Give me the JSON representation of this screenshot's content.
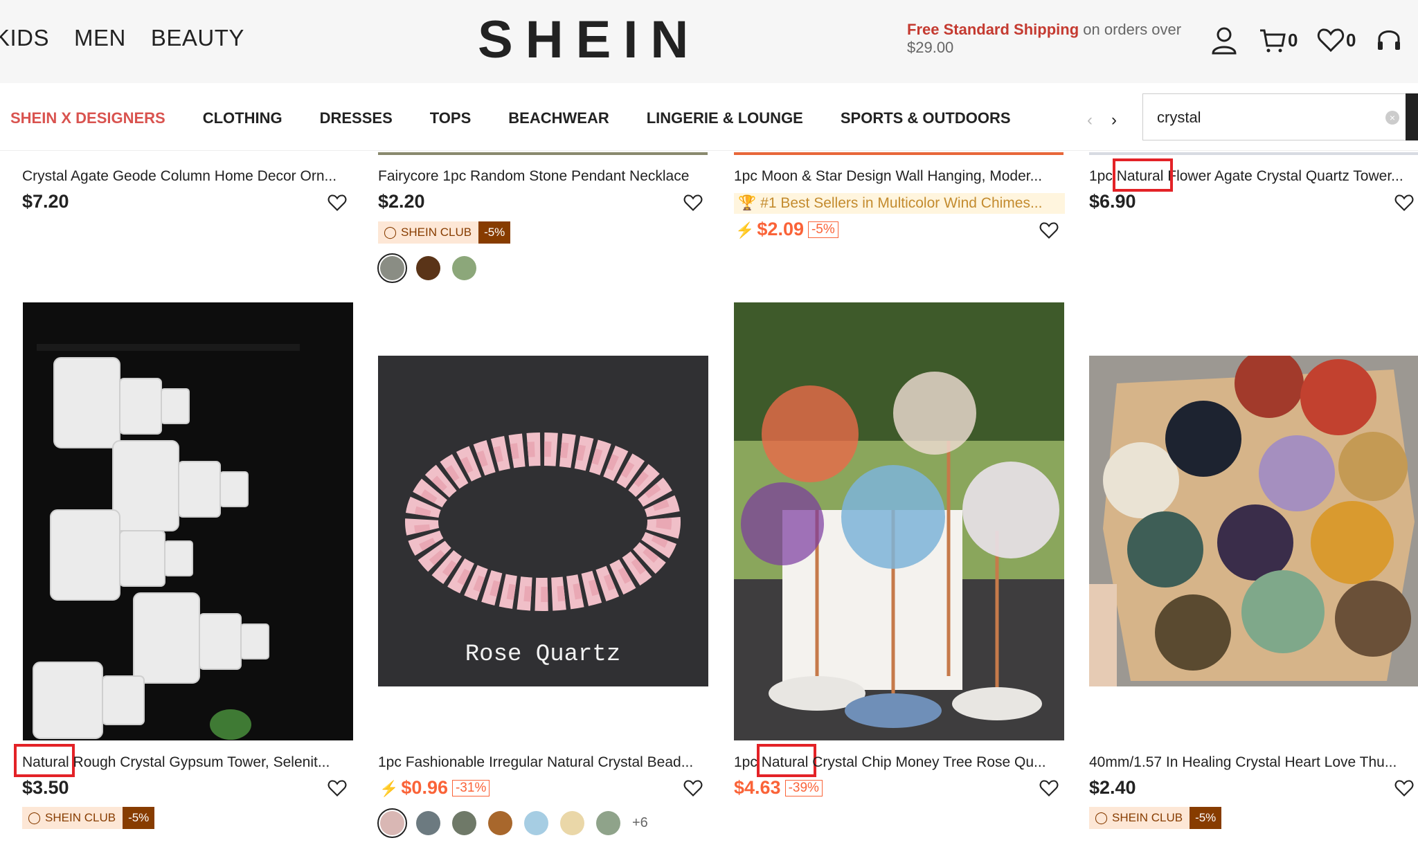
{
  "header": {
    "nav": [
      "KIDS",
      "MEN",
      "BEAUTY"
    ],
    "logo": "SHEIN",
    "shipping_highlight": "Free Standard Shipping",
    "shipping_rest": " on orders over",
    "shipping_amount": "$29.00",
    "cart_count": "0",
    "wishlist_count": "0"
  },
  "categories": [
    "SHEIN X DESIGNERS",
    "CLOTHING",
    "DRESSES",
    "TOPS",
    "BEACHWEAR",
    "LINGERIE & LOUNGE",
    "SPORTS & OUTDOORS"
  ],
  "search": {
    "value": "crystal"
  },
  "products": [
    {
      "title": "Crystal Agate Geode Column Home Decor Orn...",
      "price": "$7.20"
    },
    {
      "title": "Fairycore 1pc Random Stone Pendant Necklace",
      "price": "$2.20",
      "club_label": "SHEIN CLUB",
      "club_discount": "-5%"
    },
    {
      "title": "1pc Moon & Star Design Wall Hanging, Moder...",
      "best_seller": "#1 Best Sellers in Multicolor Wind Chimes...",
      "price": "$2.09",
      "discount": "-5%"
    },
    {
      "title_prefix": "1pc",
      "title_highlight": "Natural",
      "title_suffix": "Flower Agate Crystal Quartz Tower...",
      "price": "$6.90"
    },
    {
      "title_highlight": "Natural",
      "title_suffix": "Rough Crystal Gypsum Tower, Selenit...",
      "price": "$3.50",
      "club_label": "SHEIN CLUB",
      "club_discount": "-5%"
    },
    {
      "title": "1pc Fashionable Irregular Natural Crystal Bead...",
      "price": "$0.96",
      "discount": "-31%",
      "image_text": "Rose Quartz",
      "more_colors": "+6"
    },
    {
      "title_prefix": "1pc",
      "title_highlight": "Natural",
      "title_suffix": "Crystal Chip Money Tree Rose Qu...",
      "price": "$4.63",
      "discount": "-39%"
    },
    {
      "title": "40mm/1.57 In Healing Crystal Heart Love Thu...",
      "price": "$2.40",
      "club_label": "SHEIN CLUB",
      "club_discount": "-5%"
    }
  ],
  "colors": {
    "accent": "#d9534f",
    "sale": "#fa6338",
    "club_dark": "#873c00",
    "highlight_box": "#e32227"
  }
}
